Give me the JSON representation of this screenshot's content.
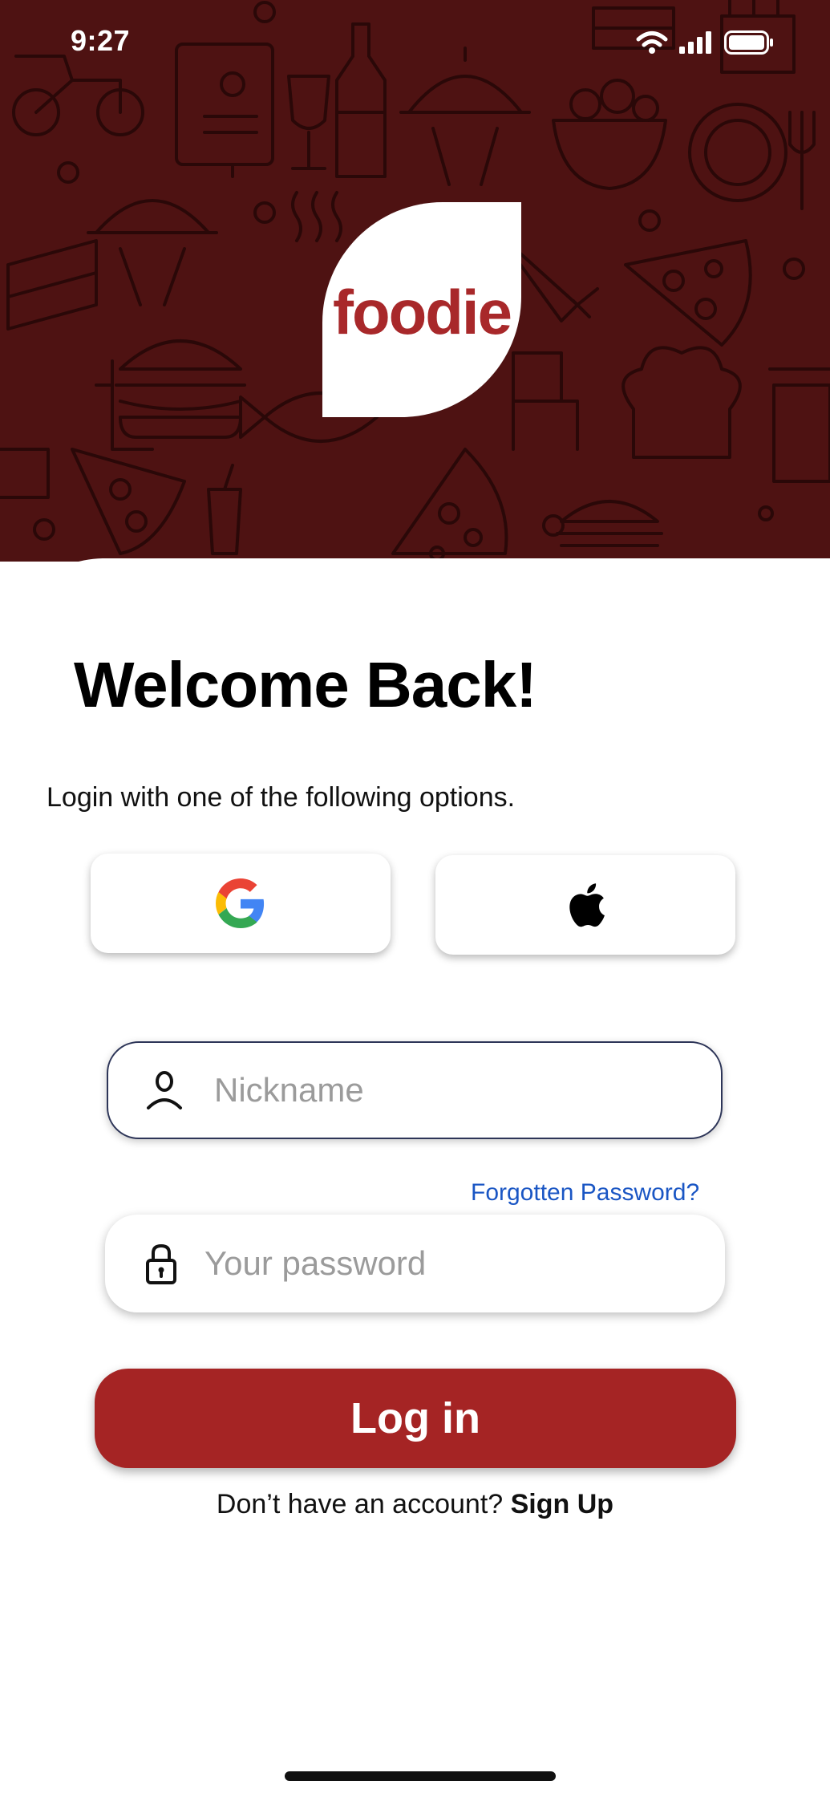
{
  "status_bar": {
    "time": "9:27",
    "icons": [
      "wifi-icon",
      "signal-icon",
      "battery-icon"
    ]
  },
  "logo": {
    "text": "foodie"
  },
  "welcome": {
    "title": "Welcome Back!",
    "subtitle": "Login with one of the following options."
  },
  "social": {
    "google": {
      "icon": "google-icon"
    },
    "apple": {
      "icon": "apple-icon"
    }
  },
  "form": {
    "nickname_placeholder": "Nickname",
    "nickname_icon": "user-icon",
    "password_placeholder": "Your password",
    "password_icon": "lock-icon",
    "forgot_label": "Forgotten Password?",
    "login_label": "Log in"
  },
  "signup": {
    "prompt": "Don’t have an account?",
    "link": "Sign Up"
  },
  "colors": {
    "brand": "#a52424",
    "hero_background": "#4e1212",
    "link": "#1a56c4",
    "field_border": "#2d3558"
  }
}
